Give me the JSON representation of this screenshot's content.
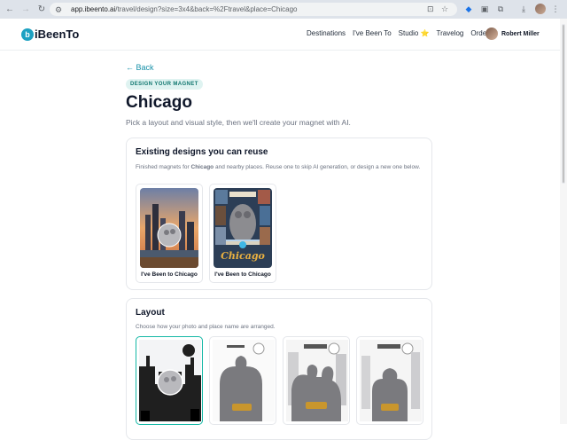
{
  "browser": {
    "url_domain": "app.ibeento.ai",
    "url_path": "/travel/design?size=3x4&back=%2Ftravel&place=Chicago"
  },
  "site": {
    "logo_text": "iBeenTo",
    "nav": [
      "Destinations",
      "I've Been To",
      "Studio ⭐",
      "Travelog",
      "Orders"
    ],
    "user_name": "Robert Miller"
  },
  "page": {
    "back_label": "← Back",
    "badge": "DESIGN YOUR MAGNET",
    "title": "Chicago",
    "subtitle": "Pick a layout and visual style, then we'll create your magnet with AI."
  },
  "existing": {
    "heading": "Existing designs you can reuse",
    "desc_pre": "Finished magnets for ",
    "desc_bold": "Chicago",
    "desc_post": " and nearby places. Reuse one to skip AI generation, or design a new one below.",
    "designs": [
      {
        "caption": "I've Been to Chicago"
      },
      {
        "caption": "I've Been to Chicago"
      }
    ]
  },
  "layout": {
    "heading": "Layout",
    "desc": "Choose how your photo and place name are arranged.",
    "options": [
      {
        "selected": true
      },
      {
        "selected": false
      },
      {
        "selected": false
      },
      {
        "selected": false
      }
    ]
  },
  "colors": {
    "accent": "#1690a8",
    "brand": "#1da1c2",
    "selected_border": "#14b8a6"
  }
}
